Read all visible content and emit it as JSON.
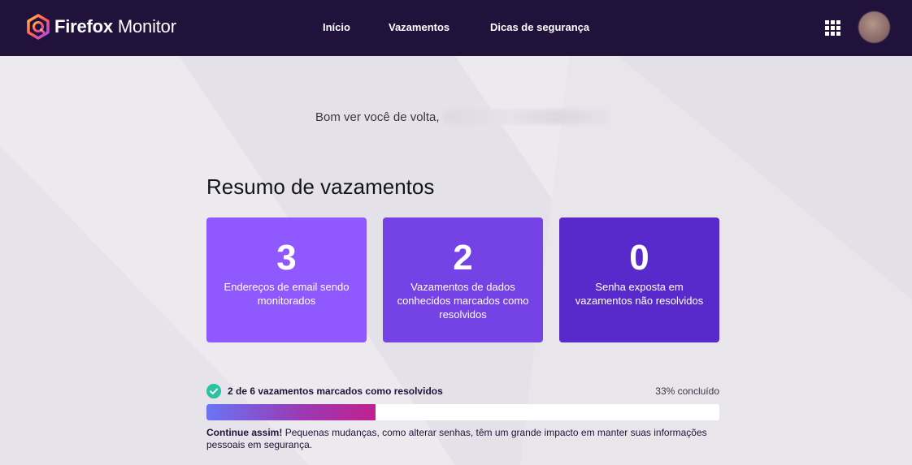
{
  "header": {
    "brand_bold": "Firefox",
    "brand_light": "Monitor",
    "nav": [
      {
        "label": "Início"
      },
      {
        "label": "Vazamentos"
      },
      {
        "label": "Dicas de segurança"
      }
    ],
    "apps_icon": "grid-apps-icon",
    "colors": {
      "background": "#20123a"
    }
  },
  "greeting": {
    "text": "Bom ver você de volta,"
  },
  "summary": {
    "title": "Resumo de vazamentos",
    "cards": [
      {
        "value": "3",
        "label": "Endereços de email sendo monitorados",
        "color": "#9059ff"
      },
      {
        "value": "2",
        "label": "Vazamentos de dados conhecidos marcados como resolvidos",
        "color": "#7542e5"
      },
      {
        "value": "0",
        "label": "Senha exposta em vazamentos não resolvidos",
        "color": "#592acb"
      }
    ]
  },
  "progress": {
    "label": "2 de 6 vazamentos marcados como resolvidos",
    "percent_text": "33% concluído",
    "fraction": 0.33,
    "encourage_bold": "Continue assim!",
    "encourage_text": " Pequenas mudanças, como alterar senhas, têm um grande impacto em manter suas informações pessoais em segurança."
  }
}
